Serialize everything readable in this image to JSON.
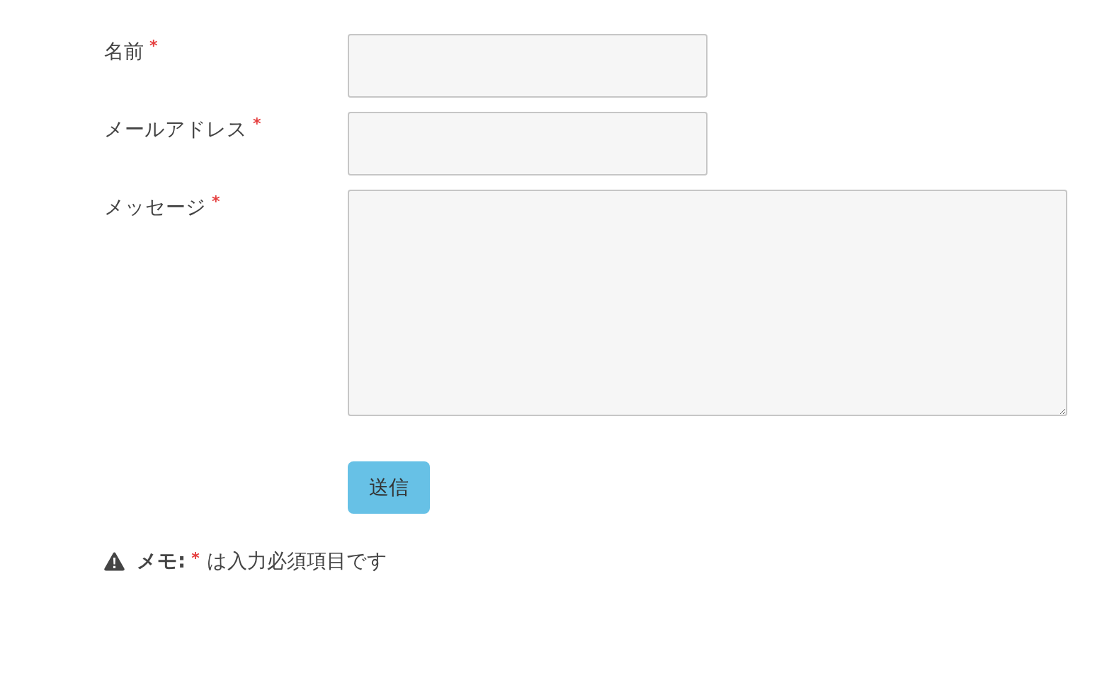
{
  "fields": [
    {
      "label": "名前",
      "required_mark": "*",
      "kind": "input"
    },
    {
      "label": "メールアドレス",
      "required_mark": "*",
      "kind": "input"
    },
    {
      "label": "メッセージ",
      "required_mark": "*",
      "kind": "textarea"
    }
  ],
  "submit_button": {
    "label": "送信"
  },
  "note": {
    "title": "メモ:",
    "mark": "*",
    "text": "は入力必須項目です"
  }
}
